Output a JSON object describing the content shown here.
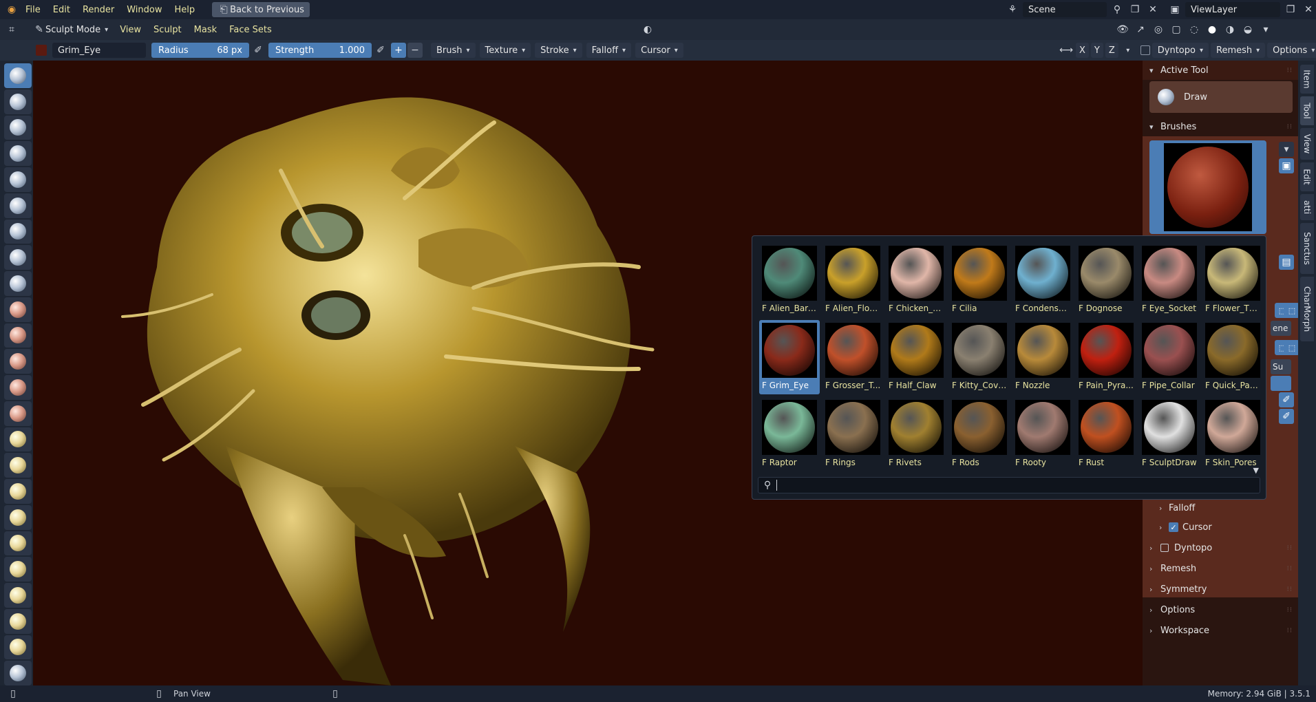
{
  "menubar": {
    "items": [
      "File",
      "Edit",
      "Render",
      "Window",
      "Help"
    ],
    "back_button": "Back to Previous",
    "scene": "Scene",
    "view_layer": "ViewLayer"
  },
  "modebar": {
    "mode": "Sculpt Mode",
    "menus": [
      "View",
      "Sculpt",
      "Mask",
      "Face Sets"
    ]
  },
  "toolheader": {
    "brush_name": "Grim_Eye",
    "radius_label": "Radius",
    "radius_value": "68 px",
    "strength_label": "Strength",
    "strength_value": "1.000",
    "menus": [
      "Brush",
      "Texture",
      "Stroke",
      "Falloff",
      "Cursor"
    ],
    "axes": [
      "X",
      "Y",
      "Z"
    ],
    "dyntopo": "Dyntopo",
    "remesh": "Remesh",
    "options": "Options"
  },
  "npanel": {
    "active_tool_header": "Active Tool",
    "active_tool": "Draw",
    "brushes_header": "Brushes",
    "partial_labels": [
      "ene",
      "Su"
    ],
    "sub_falloff": "Falloff",
    "sub_cursor": "Cursor",
    "sections": [
      "Dyntopo",
      "Remesh",
      "Symmetry",
      "Options",
      "Workspace"
    ]
  },
  "side_tabs": [
    "Item",
    "Tool",
    "View",
    "Edit",
    "atti",
    "Sanctus",
    "CharMorph"
  ],
  "popup": {
    "brushes": [
      {
        "label": "F Alien_Barn...",
        "color": "#4f8a78"
      },
      {
        "label": "F Alien_Flow...",
        "color": "#c9a02a"
      },
      {
        "label": "F Chicken_Skin",
        "color": "#e0b6a8"
      },
      {
        "label": "F Cilia",
        "color": "#c07a1a"
      },
      {
        "label": "F Condensat...",
        "color": "#6fb0cf"
      },
      {
        "label": "F Dognose",
        "color": "#9a8a6a"
      },
      {
        "label": "F Eye_Socket",
        "color": "#c88a82"
      },
      {
        "label": "F Flower_Thi...",
        "color": "#c8b878"
      },
      {
        "label": "F Grim_Eye",
        "color": "#8a2a1a"
      },
      {
        "label": "F Grosser_T...",
        "color": "#c0502a"
      },
      {
        "label": "F Half_Claw",
        "color": "#b07a1a"
      },
      {
        "label": "F Kitty_Coven",
        "color": "#8a8070"
      },
      {
        "label": "F Nozzle",
        "color": "#b88a3a"
      },
      {
        "label": "F Pain_Pyra...",
        "color": "#c02010"
      },
      {
        "label": "F Pipe_Collar",
        "color": "#9a5050"
      },
      {
        "label": "F Quick_Panel",
        "color": "#8a6a2a"
      },
      {
        "label": "F Raptor",
        "color": "#7ab898"
      },
      {
        "label": "F Rings",
        "color": "#8a7050"
      },
      {
        "label": "F Rivets",
        "color": "#a08030"
      },
      {
        "label": "F Rods",
        "color": "#8a6030"
      },
      {
        "label": "F Rooty",
        "color": "#a07a70"
      },
      {
        "label": "F Rust",
        "color": "#c05020"
      },
      {
        "label": "F SculptDraw",
        "color": "#e0e0e0"
      },
      {
        "label": "F Skin_Pores",
        "color": "#d0a898"
      }
    ],
    "search_value": ""
  },
  "status": {
    "left": "Pan View",
    "right": "Memory: 2.94 GiB | 3.5.1"
  }
}
